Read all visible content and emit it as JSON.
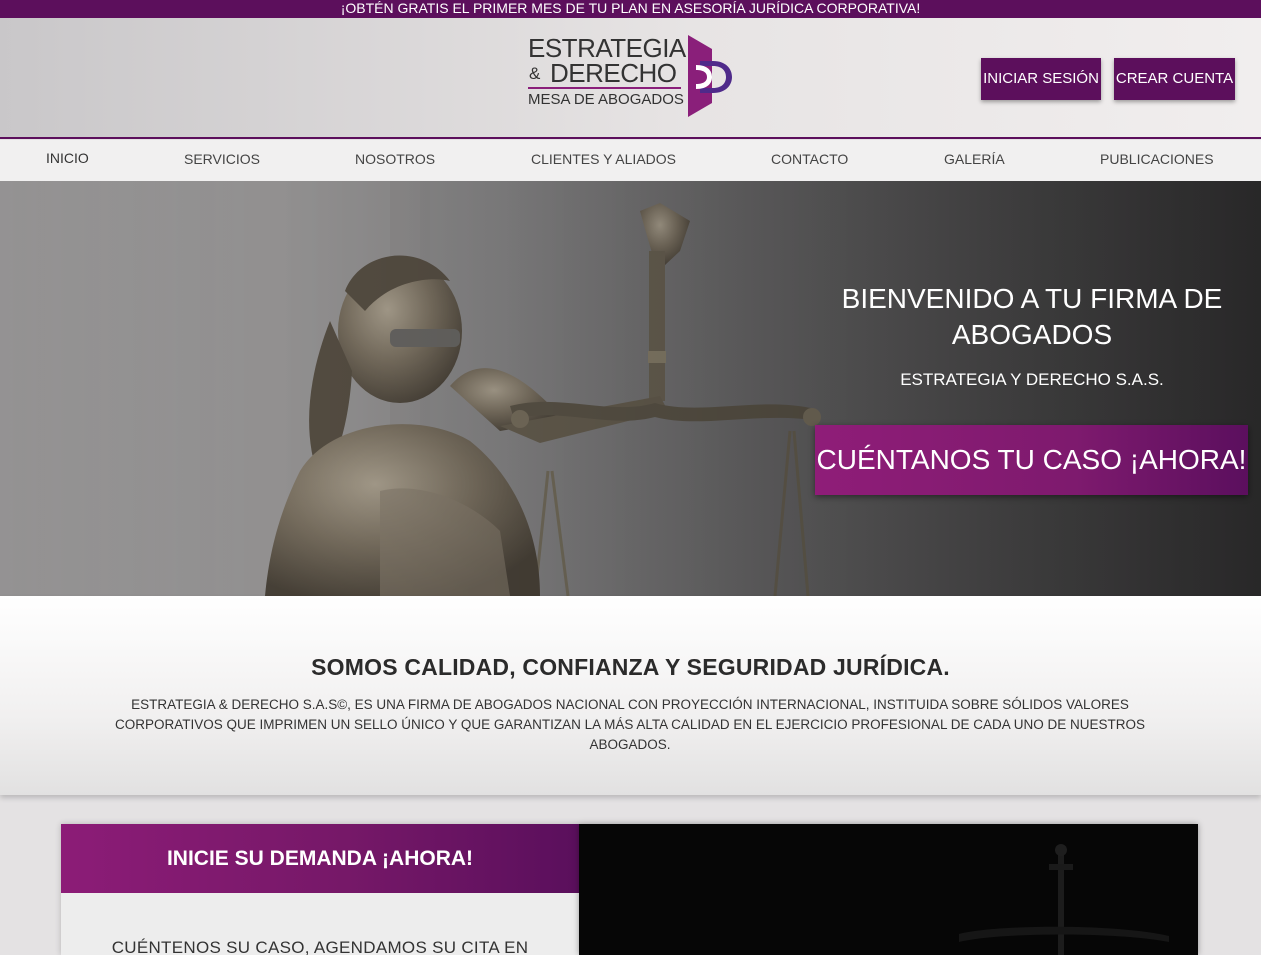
{
  "promo": {
    "text": "¡OBTÉN GRATIS EL PRIMER MES DE TU PLAN EN ASESORÍA JURÍDICA CORPORATIVA!"
  },
  "logo": {
    "line1": "ESTRATEGIA",
    "amp": "&",
    "line2": "DERECHO",
    "line3": "MESA DE ABOGADOS"
  },
  "auth": {
    "login_label": "INICIAR SESIÓN",
    "signup_label": "CREAR CUENTA"
  },
  "nav": {
    "items": [
      {
        "label": "INICIO"
      },
      {
        "label": "SERVICIOS"
      },
      {
        "label": "NOSOTROS"
      },
      {
        "label": "CLIENTES Y ALIADOS"
      },
      {
        "label": "CONTACTO"
      },
      {
        "label": "GALERÍA"
      },
      {
        "label": "PUBLICACIONES"
      }
    ]
  },
  "hero": {
    "title": "BIENVENIDO A TU FIRMA DE ABOGADOS",
    "subtitle": "ESTRATEGIA Y DERECHO S.A.S.",
    "cta_label": "CUÉNTANOS TU CASO ¡AHORA!"
  },
  "about": {
    "title": "SOMOS CALIDAD, CONFIANZA Y SEGURIDAD JURÍDICA.",
    "text": "ESTRATEGIA & DERECHO S.A.S©, ES UNA FIRMA DE ABOGADOS NACIONAL CON PROYECCIÓN INTERNACIONAL, INSTITUIDA SOBRE SÓLIDOS VALORES CORPORATIVOS QUE IMPRIMEN UN SELLO ÚNICO Y QUE GARANTIZAN LA MÁS ALTA CALIDAD EN EL EJERCICIO PROFESIONAL DE CADA UNO DE NUESTROS ABOGADOS."
  },
  "demand": {
    "title": "INICIE SU DEMANDA ¡AHORA!",
    "text": "CUÉNTENOS SU CASO, AGENDAMOS SU CITA EN"
  },
  "colors": {
    "brand_purple": "#5c0f5c",
    "accent_magenta": "#8f1d78"
  }
}
